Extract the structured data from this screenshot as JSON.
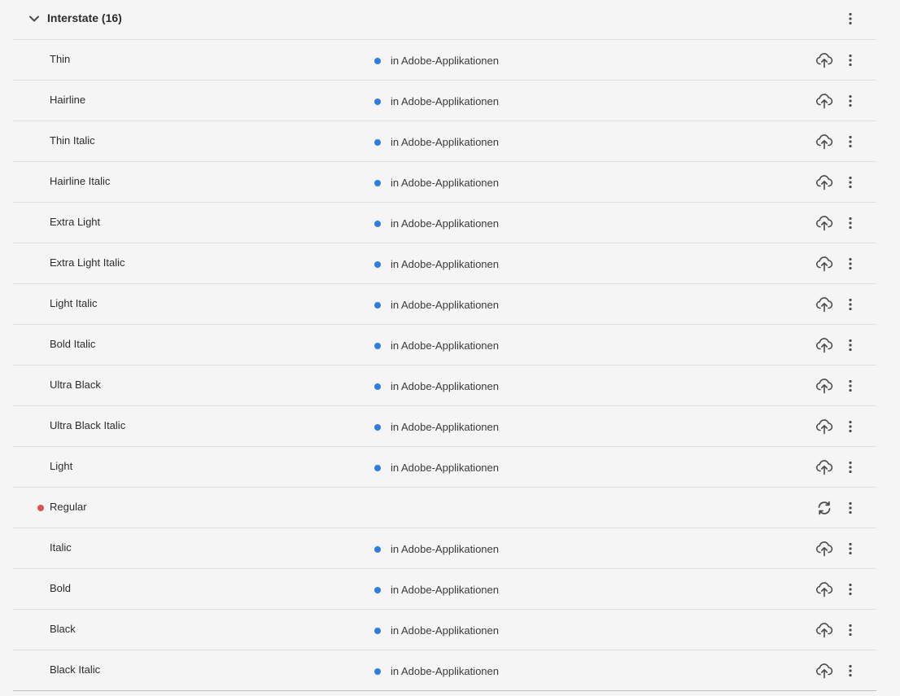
{
  "family": {
    "title": "Interstate (16)",
    "expand_icon": "chevron-down-icon",
    "more_icon": "more-vertical-icon"
  },
  "colors": {
    "active_dot": "#2d7ee0",
    "warning_dot": "#d9534f",
    "icon": "#4b4b4b"
  },
  "styles": [
    {
      "name": "Thin",
      "status": "in Adobe-Applikationen",
      "action_icon": "cloud-upload-icon"
    },
    {
      "name": "Hairline",
      "status": "in Adobe-Applikationen",
      "action_icon": "cloud-upload-icon"
    },
    {
      "name": "Thin Italic",
      "status": "in Adobe-Applikationen",
      "action_icon": "cloud-upload-icon"
    },
    {
      "name": "Hairline Italic",
      "status": "in Adobe-Applikationen",
      "action_icon": "cloud-upload-icon"
    },
    {
      "name": "Extra Light",
      "status": "in Adobe-Applikationen",
      "action_icon": "cloud-upload-icon"
    },
    {
      "name": "Extra Light Italic",
      "status": "in Adobe-Applikationen",
      "action_icon": "cloud-upload-icon"
    },
    {
      "name": "Light Italic",
      "status": "in Adobe-Applikationen",
      "action_icon": "cloud-upload-icon"
    },
    {
      "name": "Bold Italic",
      "status": "in Adobe-Applikationen",
      "action_icon": "cloud-upload-icon"
    },
    {
      "name": "Ultra Black",
      "status": "in Adobe-Applikationen",
      "action_icon": "cloud-upload-icon"
    },
    {
      "name": "Ultra Black Italic",
      "status": "in Adobe-Applikationen",
      "action_icon": "cloud-upload-icon"
    },
    {
      "name": "Light",
      "status": "in Adobe-Applikationen",
      "action_icon": "cloud-upload-icon"
    },
    {
      "name": "Regular",
      "status": "",
      "warning": true,
      "action_icon": "sync-icon"
    },
    {
      "name": "Italic",
      "status": "in Adobe-Applikationen",
      "action_icon": "cloud-upload-icon"
    },
    {
      "name": "Bold",
      "status": "in Adobe-Applikationen",
      "action_icon": "cloud-upload-icon"
    },
    {
      "name": "Black",
      "status": "in Adobe-Applikationen",
      "action_icon": "cloud-upload-icon"
    },
    {
      "name": "Black Italic",
      "status": "in Adobe-Applikationen",
      "action_icon": "cloud-upload-icon"
    }
  ]
}
